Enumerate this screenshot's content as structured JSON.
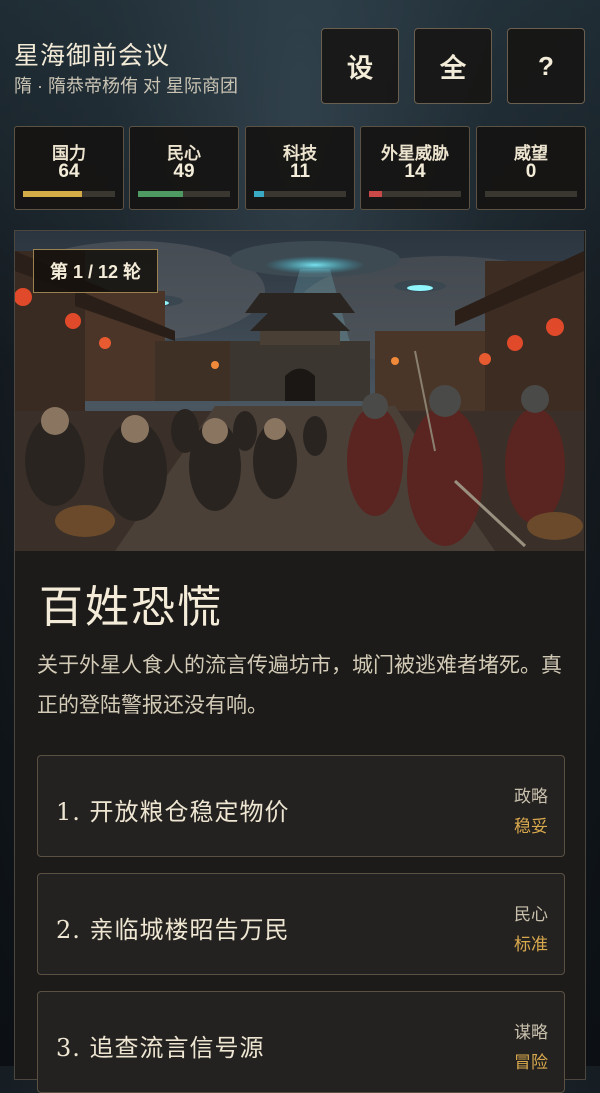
{
  "header": {
    "title": "星海御前会议",
    "subtitle": "隋 · 隋恭帝杨侑 对 星际商团",
    "buttons": {
      "settings": "设",
      "fullscreen": "全",
      "help": "?"
    }
  },
  "stats": [
    {
      "label": "国力",
      "value": "64",
      "level": 0.64,
      "color": "#d4ab47"
    },
    {
      "label": "民心",
      "value": "49",
      "level": 0.49,
      "color": "#4f9a62"
    },
    {
      "label": "科技",
      "value": "11",
      "level": 0.11,
      "color": "#3aa9c4"
    },
    {
      "label": "外星威胁",
      "value": "14",
      "level": 0.14,
      "color": "#c94848"
    },
    {
      "label": "威望",
      "value": "0",
      "level": 0.0,
      "color": "#9a8a5a"
    }
  ],
  "event": {
    "round": "第 1 / 12 轮",
    "title": "百姓恐慌",
    "description": "关于外星人食人的流言传遍坊市，城门被逃难者堵死。真正的登陆警报还没有响。",
    "choices": [
      {
        "text": "1.  开放粮仓稳定物价",
        "category": "政略",
        "risk": "稳妥"
      },
      {
        "text": "2.  亲临城楼昭告万民",
        "category": "民心",
        "risk": "标准"
      },
      {
        "text": "3.  追查流言信号源",
        "category": "谋略",
        "risk": "冒险"
      }
    ]
  }
}
